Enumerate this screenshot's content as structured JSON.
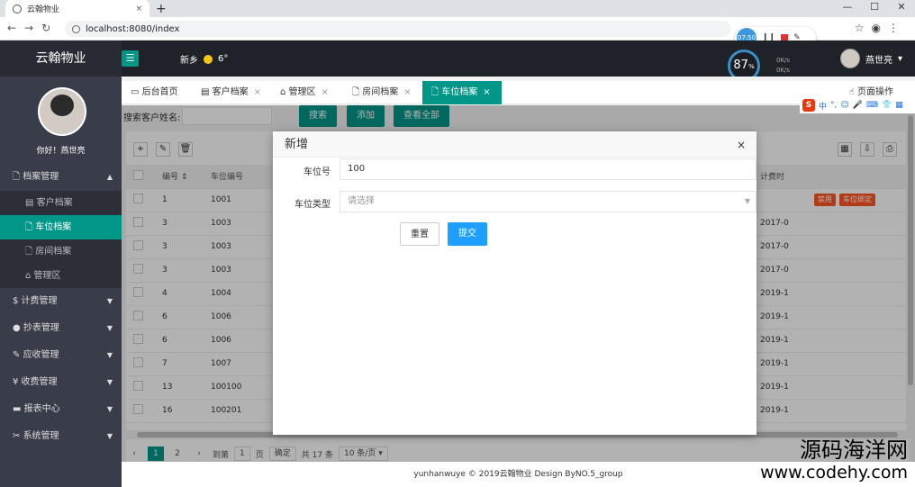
{
  "browser": {
    "tab_title": "云翰物业",
    "tab_close": "×",
    "new_tab": "+",
    "url": "localhost:8080/index",
    "recorder_time": "07:50"
  },
  "header": {
    "logo": "云翰物业",
    "weather_city": "新乡",
    "weather_temp": "6°",
    "gauge_value": "87",
    "gauge_unit": "%",
    "speed_up": "0K/s",
    "speed_down": "0K/s",
    "user_name": "燕世亮"
  },
  "sidebar": {
    "greeting": "你好！燕世亮",
    "groups": [
      {
        "label": "档案管理"
      },
      {
        "label": "计费管理"
      },
      {
        "label": "抄表管理"
      },
      {
        "label": "应收管理"
      },
      {
        "label": "收费管理"
      },
      {
        "label": "报表中心"
      },
      {
        "label": "系统管理"
      }
    ],
    "sub_items": [
      {
        "label": "客户档案"
      },
      {
        "label": "车位档案"
      },
      {
        "label": "房间档案"
      },
      {
        "label": "管理区"
      }
    ]
  },
  "tabs": [
    {
      "label": "后台首页"
    },
    {
      "label": "客户档案"
    },
    {
      "label": "管理区"
    },
    {
      "label": "房间档案"
    },
    {
      "label": "车位档案"
    }
  ],
  "tab_close": "×",
  "page_ops": "页面操作",
  "search": {
    "label": "搜索客户姓名:",
    "search_btn": "搜索",
    "add_btn": "添加",
    "view_all_btn": "查看全部"
  },
  "table": {
    "headers": [
      "编号",
      "车位编号",
      "计费时"
    ],
    "rows": [
      {
        "id": "1",
        "code": "1001",
        "time": ""
      },
      {
        "id": "3",
        "code": "1003",
        "time": "2017-0"
      },
      {
        "id": "3",
        "code": "1003",
        "time": "2017-0"
      },
      {
        "id": "3",
        "code": "1003",
        "time": "2017-0"
      },
      {
        "id": "4",
        "code": "1004",
        "time": "2019-1"
      },
      {
        "id": "6",
        "code": "1006",
        "time": "2019-1"
      },
      {
        "id": "6",
        "code": "1006",
        "time": "2019-1"
      },
      {
        "id": "7",
        "code": "1007",
        "time": "2019-1"
      },
      {
        "id": "13",
        "code": "100100",
        "time": "2019-1"
      },
      {
        "id": "16",
        "code": "100201",
        "time": "2019-1"
      }
    ],
    "row_actions": {
      "disable": "禁用",
      "bind": "车位绑定"
    }
  },
  "pager": {
    "page1": "1",
    "page2": "2",
    "goto_label": "到第",
    "goto_value": "1",
    "page_word": "页",
    "confirm": "确定",
    "total": "共 17 条",
    "per_page": "10 条/页"
  },
  "footer": "yunhanwuye © 2019云翰物业 Design ByNO.5_group",
  "modal": {
    "title": "新增",
    "close": "×",
    "field1_label": "车位号",
    "field1_value": "100",
    "field2_label": "车位类型",
    "field2_placeholder": "请选择",
    "reset_btn": "重置",
    "submit_btn": "提交"
  },
  "watermark": {
    "line1": "源码海洋网",
    "line2": "www.codehy.com"
  },
  "colors": {
    "accent": "#009688",
    "sidebar_bg": "#393d49",
    "topbar_bg": "#20222a",
    "danger": "#ff5722",
    "primary": "#1e9fff"
  }
}
